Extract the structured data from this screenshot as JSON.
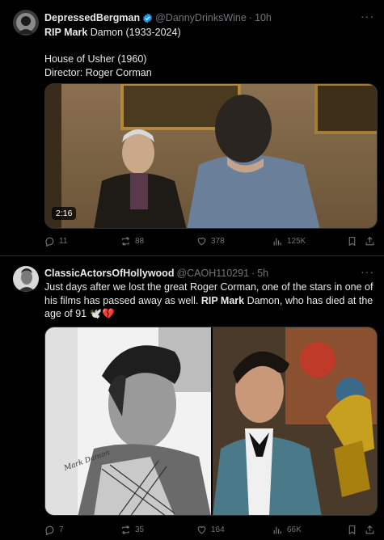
{
  "tweets": [
    {
      "display_name": "DepressedBergman",
      "handle": "@DannyDrinksWine",
      "dot": "·",
      "time": "10h",
      "line1_bold": "RIP Mark",
      "line1_rest": " Damon (1933-2024)",
      "line2": "House of Usher (1960)",
      "line3": "Director: Roger Corman",
      "video_duration": "2:16",
      "replies": "11",
      "reposts": "88",
      "likes": "378",
      "views": "125K"
    },
    {
      "display_name": "ClassicActorsOfHollywood",
      "handle": "@CAOH110291",
      "dot": "·",
      "time": "5h",
      "text_a": "Just days after we lost the great Roger Corman, one of the stars in one of his films has passed away as well. ",
      "text_bold": "RIP Mark",
      "text_b": " Damon, who has died at the age of 91 ",
      "emoji": "🕊️💔",
      "signature": "Mark Damon",
      "replies": "7",
      "reposts": "35",
      "likes": "164",
      "views": "66K"
    }
  ],
  "more_label": "···",
  "colors": {
    "accent": "#1d9bf0",
    "muted": "#71767b",
    "text": "#e7e9ea",
    "border": "#2f3336",
    "heart": "#f91880"
  }
}
